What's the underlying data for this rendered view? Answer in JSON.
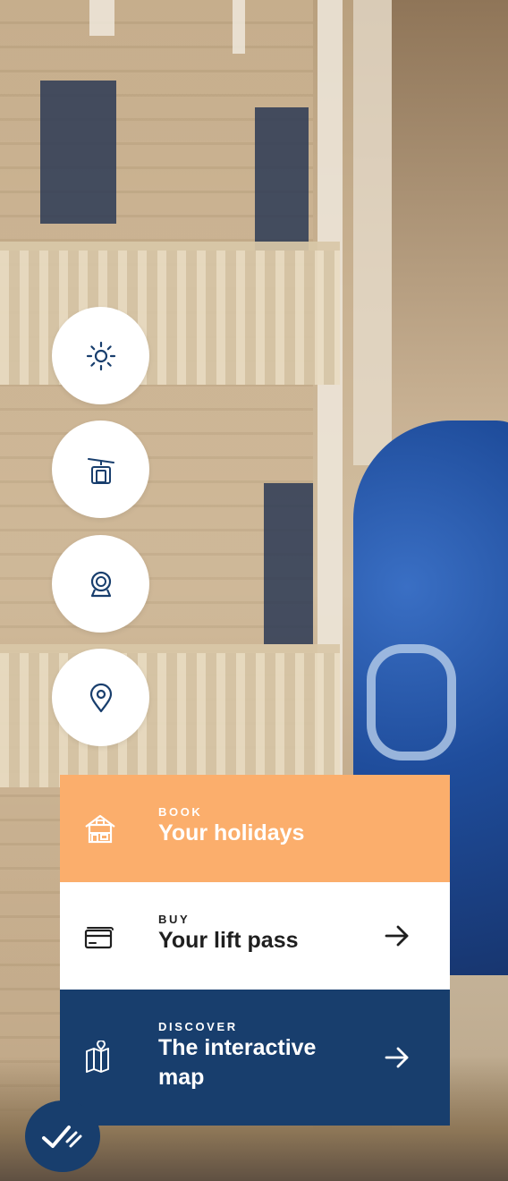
{
  "quick_actions": [
    {
      "name": "weather",
      "icon": "sun-icon"
    },
    {
      "name": "lifts",
      "icon": "gondola-lift-icon"
    },
    {
      "name": "webcams",
      "icon": "webcam-icon"
    },
    {
      "name": "location",
      "icon": "map-pin-icon"
    }
  ],
  "cards": {
    "book": {
      "eyebrow": "BOOK",
      "title": "Your holidays",
      "icon": "chalet-icon",
      "background": "#fbae6c"
    },
    "buy": {
      "eyebrow": "BUY",
      "title": "Your lift pass",
      "icon": "card-icon",
      "background": "#ffffff"
    },
    "discover": {
      "eyebrow": "DISCOVER",
      "title_line1": "The interactive",
      "title_line2": "map",
      "icon": "folded-map-icon",
      "background": "#183e6d"
    }
  },
  "colors": {
    "navy": "#183e6d",
    "orange": "#fbae6c",
    "white": "#ffffff"
  },
  "fab": {
    "icon": "checklist-icon"
  }
}
